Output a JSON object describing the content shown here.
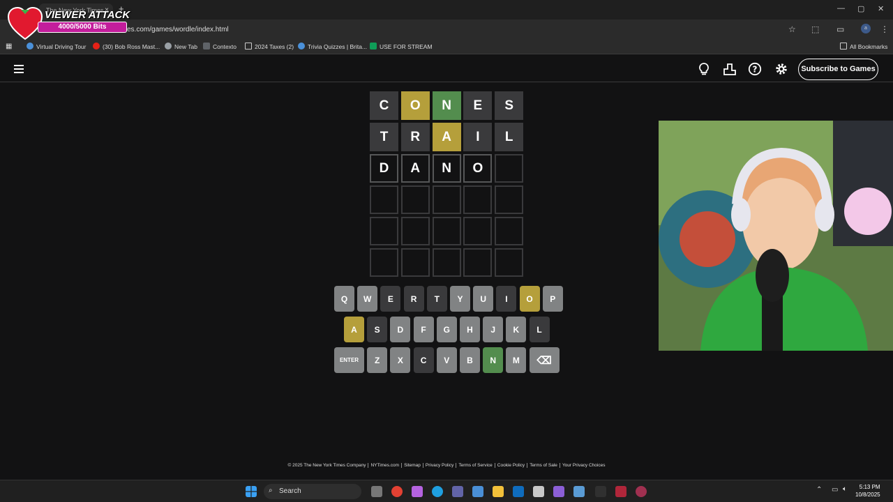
{
  "browser": {
    "tab_title": "The New York Times",
    "tab_close": "×",
    "new_tab": "+",
    "url": "es.com/games/wordle/index.html",
    "win_min": "—",
    "win_max": "▢",
    "win_close": "✕",
    "bookmarks": [
      {
        "label": "Virtual Driving Tour",
        "color": "#4a90d9"
      },
      {
        "label": "(30) Bob Ross Mast...",
        "color": "#e62117"
      },
      {
        "label": "New Tab",
        "color": "#9aa0a6"
      },
      {
        "label": "Contexto",
        "color": "#5f6368"
      },
      {
        "label": "2024 Taxes (2)",
        "color": "#5f6368"
      },
      {
        "label": "Trivia Quizzes | Brita...",
        "color": "#4a90d9"
      },
      {
        "label": "USE FOR STREAM",
        "color": "#0f9d58"
      }
    ],
    "all_bookmarks": "All Bookmarks"
  },
  "overlay": {
    "title": "VIEWER ATTACK",
    "bits": "4000/5000 Bits",
    "bits_progress": 0.8
  },
  "header": {
    "subscribe": "Subscribe to Games"
  },
  "board": [
    [
      {
        "l": "C",
        "s": "absent"
      },
      {
        "l": "O",
        "s": "present"
      },
      {
        "l": "N",
        "s": "correct"
      },
      {
        "l": "E",
        "s": "absent"
      },
      {
        "l": "S",
        "s": "absent"
      }
    ],
    [
      {
        "l": "T",
        "s": "absent"
      },
      {
        "l": "R",
        "s": "absent"
      },
      {
        "l": "A",
        "s": "present"
      },
      {
        "l": "I",
        "s": "absent"
      },
      {
        "l": "L",
        "s": "absent"
      }
    ],
    [
      {
        "l": "D",
        "s": "typed"
      },
      {
        "l": "A",
        "s": "typed"
      },
      {
        "l": "N",
        "s": "typed"
      },
      {
        "l": "O",
        "s": "typed"
      },
      {
        "l": "",
        "s": "empty"
      }
    ],
    [
      {
        "l": "",
        "s": "empty"
      },
      {
        "l": "",
        "s": "empty"
      },
      {
        "l": "",
        "s": "empty"
      },
      {
        "l": "",
        "s": "empty"
      },
      {
        "l": "",
        "s": "empty"
      }
    ],
    [
      {
        "l": "",
        "s": "empty"
      },
      {
        "l": "",
        "s": "empty"
      },
      {
        "l": "",
        "s": "empty"
      },
      {
        "l": "",
        "s": "empty"
      },
      {
        "l": "",
        "s": "empty"
      }
    ],
    [
      {
        "l": "",
        "s": "empty"
      },
      {
        "l": "",
        "s": "empty"
      },
      {
        "l": "",
        "s": "empty"
      },
      {
        "l": "",
        "s": "empty"
      },
      {
        "l": "",
        "s": "empty"
      }
    ]
  ],
  "keyboard": [
    [
      {
        "k": "Q",
        "s": "none"
      },
      {
        "k": "W",
        "s": "none"
      },
      {
        "k": "E",
        "s": "absent"
      },
      {
        "k": "R",
        "s": "absent"
      },
      {
        "k": "T",
        "s": "absent"
      },
      {
        "k": "Y",
        "s": "none"
      },
      {
        "k": "U",
        "s": "none"
      },
      {
        "k": "I",
        "s": "absent"
      },
      {
        "k": "O",
        "s": "present"
      },
      {
        "k": "P",
        "s": "none"
      }
    ],
    [
      {
        "k": "A",
        "s": "present"
      },
      {
        "k": "S",
        "s": "absent"
      },
      {
        "k": "D",
        "s": "none"
      },
      {
        "k": "F",
        "s": "none"
      },
      {
        "k": "G",
        "s": "none"
      },
      {
        "k": "H",
        "s": "none"
      },
      {
        "k": "J",
        "s": "none"
      },
      {
        "k": "K",
        "s": "none"
      },
      {
        "k": "L",
        "s": "absent"
      }
    ],
    [
      {
        "k": "ENTER",
        "s": "none"
      },
      {
        "k": "Z",
        "s": "none"
      },
      {
        "k": "X",
        "s": "none"
      },
      {
        "k": "C",
        "s": "absent"
      },
      {
        "k": "V",
        "s": "none"
      },
      {
        "k": "B",
        "s": "none"
      },
      {
        "k": "N",
        "s": "correct"
      },
      {
        "k": "M",
        "s": "none"
      },
      {
        "k": "⌫",
        "s": "none"
      }
    ]
  ],
  "footer": [
    "© 2025 The New York Times Company",
    "NYTimes.com",
    "Sitemap",
    "Privacy Policy",
    "Terms of Service",
    "Cookie Policy",
    "Terms of Sale",
    "Your Privacy Choices"
  ],
  "taskbar": {
    "search": "Search",
    "time": "5:13 PM",
    "date": "10/8/2025"
  },
  "colors": {
    "correct": "#538d4e",
    "present": "#b59f3b",
    "absent": "#3a3a3c",
    "unused_key": "#818384",
    "background": "#121213"
  },
  "icons": [
    "heart-icon",
    "hamburger-icon",
    "hint-lightbulb-icon",
    "stats-icon",
    "help-icon",
    "settings-gear-icon",
    "backspace-icon",
    "windows-start-icon",
    "search-icon"
  ]
}
